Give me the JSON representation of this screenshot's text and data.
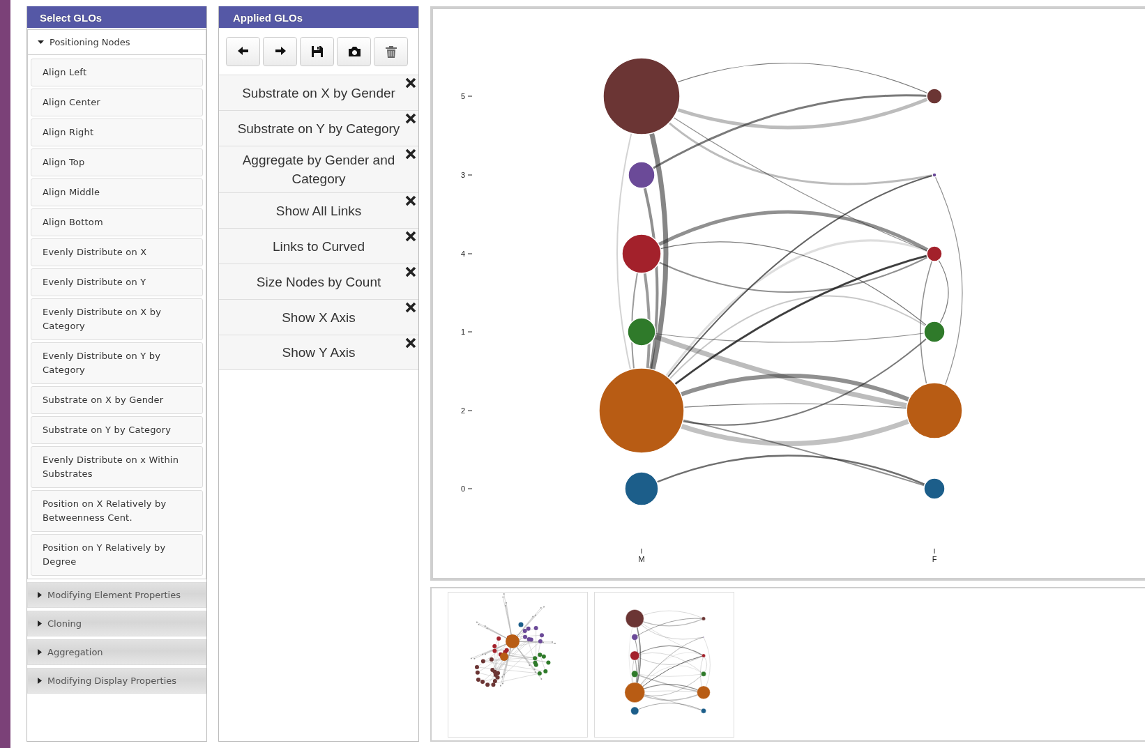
{
  "select_panel": {
    "title": "Select GLOs",
    "sections": [
      {
        "label": "Positioning Nodes",
        "expanded": true,
        "items": [
          "Align Left",
          "Align Center",
          "Align Right",
          "Align Top",
          "Align Middle",
          "Align Bottom",
          "Evenly Distribute on X",
          "Evenly Distribute on Y",
          "Evenly Distribute on X by Category",
          "Evenly Distribute on Y by Category",
          "Substrate on X by Gender",
          "Substrate on Y by Category",
          "Evenly Distribute on x Within Substrates",
          "Position on X Relatively by Betweenness Cent.",
          "Position on Y Relatively by Degree"
        ]
      },
      {
        "label": "Modifying Element Properties",
        "expanded": false
      },
      {
        "label": "Cloning",
        "expanded": false
      },
      {
        "label": "Aggregation",
        "expanded": false
      },
      {
        "label": "Modifying Display Properties",
        "expanded": false
      }
    ]
  },
  "applied_panel": {
    "title": "Applied GLOs",
    "items": [
      "Substrate on X by Gender",
      "Substrate on Y by Category",
      "Aggregate by Gender and Category",
      "Show All Links",
      "Links to Curved",
      "Size Nodes by Count",
      "Show X Axis",
      "Show Y Axis"
    ]
  },
  "graph": {
    "y_ticks": [
      "5",
      "3",
      "4",
      "1",
      "2",
      "0"
    ],
    "x_ticks": [
      "M",
      "F"
    ]
  },
  "thumbnails": [
    {
      "kind": "force"
    },
    {
      "kind": "substrate"
    }
  ]
}
